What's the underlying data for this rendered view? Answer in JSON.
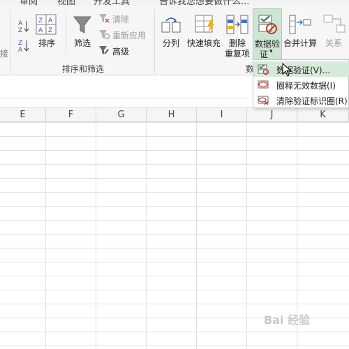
{
  "tabs": [
    "审阅",
    "视图",
    "开发工具",
    "告诉我您想要做什么..."
  ],
  "ribbon": {
    "partial_left_label": "接",
    "sort_group": {
      "sort_label": "排序",
      "filter_label": "筛选",
      "clear_label": "清除",
      "reapply_label": "重新应用",
      "advanced_label": "高级",
      "group_label": "排序和筛选"
    },
    "data_tools": {
      "split_label": "分列",
      "flash_fill_label": "快速填充",
      "remove_dup_label_1": "删除",
      "remove_dup_label_2": "重复项",
      "validation_label_1": "数据验",
      "validation_label_2": "证",
      "validation_arrow": "▾",
      "consolidate_label": "合并计算",
      "relations_label": "关系",
      "group_label_partial": "数"
    }
  },
  "dropdown": {
    "items": [
      {
        "label": "数据验证(V)..."
      },
      {
        "label": "圈释无效数据(I)"
      },
      {
        "label": "清除验证标识圈(R)"
      }
    ]
  },
  "columns": [
    "E",
    "F",
    "G",
    "H",
    "I",
    "J",
    "K"
  ],
  "watermark": "Bai 经验",
  "colors": {
    "accent_green": "#217346",
    "highlight": "#d6ead9",
    "ribbon_bg": "#f6f6f6"
  }
}
